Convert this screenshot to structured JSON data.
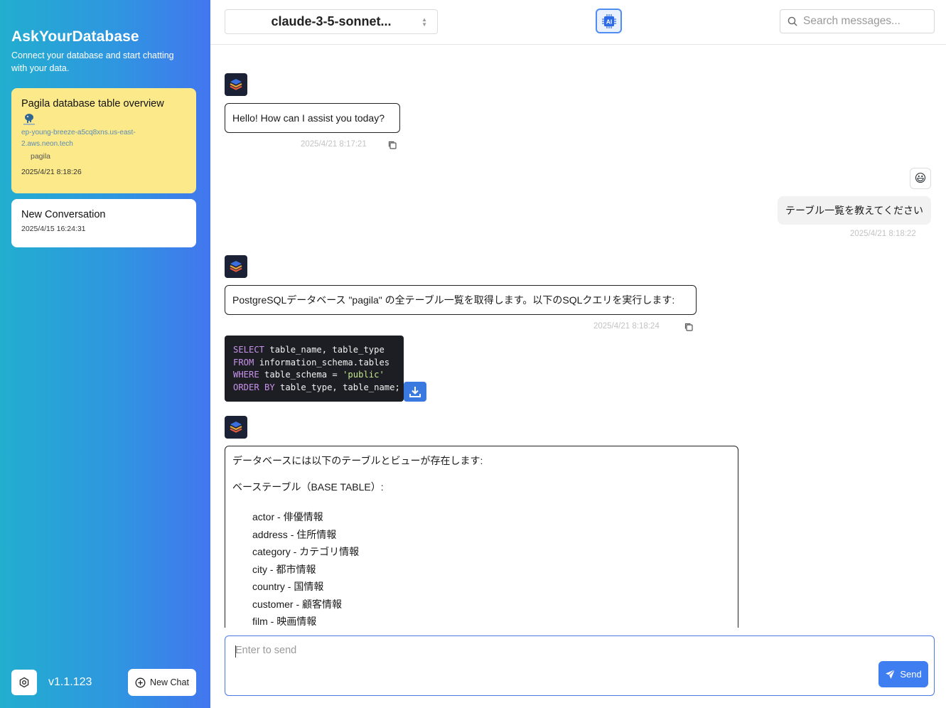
{
  "app": {
    "title": "AskYourDatabase",
    "subtitle": "Connect your database and start chatting with your data.",
    "version": "v1.1.123",
    "new_chat_label": "New Chat"
  },
  "conversations": [
    {
      "title": "Pagila database table overview",
      "host": "ep-young-breeze-a5cq8xns.us-east-2.aws.neon.tech",
      "database": "pagila",
      "time": "2025/4/21 8:18:26",
      "active": true
    },
    {
      "title": "New Conversation",
      "time": "2025/4/15 16:24:31",
      "active": false
    }
  ],
  "header": {
    "model": "claude-3-5-sonnet...",
    "search_placeholder": "Search messages..."
  },
  "messages": [
    {
      "role": "assistant",
      "text": "Hello! How can I assist you today?",
      "time": "2025/4/21 8:17:21"
    },
    {
      "role": "user",
      "text": "テーブル一覧を教えてください",
      "time": "2025/4/21 8:18:22"
    },
    {
      "role": "assistant",
      "text": "PostgreSQLデータベース \"pagila\" の全テーブル一覧を取得します。以下のSQLクエリを実行します:",
      "time": "2025/4/21 8:18:24"
    },
    {
      "role": "assistant",
      "intro": "データベースには以下のテーブルとビューが存在します:",
      "section": "ベーステーブル（BASE TABLE）:",
      "items": [
        "actor - 俳優情報",
        "address - 住所情報",
        "category - カテゴリ情報",
        "city - 都市情報",
        "country - 国情報",
        "customer - 顧客情報",
        "film - 映画情報"
      ]
    }
  ],
  "sql": {
    "l1_kw": "SELECT",
    "l1_rest": " table_name, table_type",
    "l2_kw": "FROM",
    "l2_rest": " information_schema.tables",
    "l3_kw": "WHERE",
    "l3_mid": " table_schema = ",
    "l3_str": "'public'",
    "l4_kw": "ORDER BY",
    "l4_rest": " table_type, table_name;"
  },
  "composer": {
    "placeholder": "Enter to send",
    "send_label": "Send"
  },
  "icons": {
    "settings": "settings-icon",
    "new_chat": "plus-circle-icon",
    "search": "search-icon",
    "ai": "ai-chip-icon",
    "copy": "copy-icon",
    "download": "download-icon",
    "send": "send-icon",
    "user_avatar": "smiley-icon",
    "bot_avatar": "database-stack-icon"
  },
  "colors": {
    "sidebar_start": "#22aecf",
    "sidebar_end": "#4276ef",
    "active_card": "#fbe98a",
    "accent": "#3f7ef0"
  }
}
